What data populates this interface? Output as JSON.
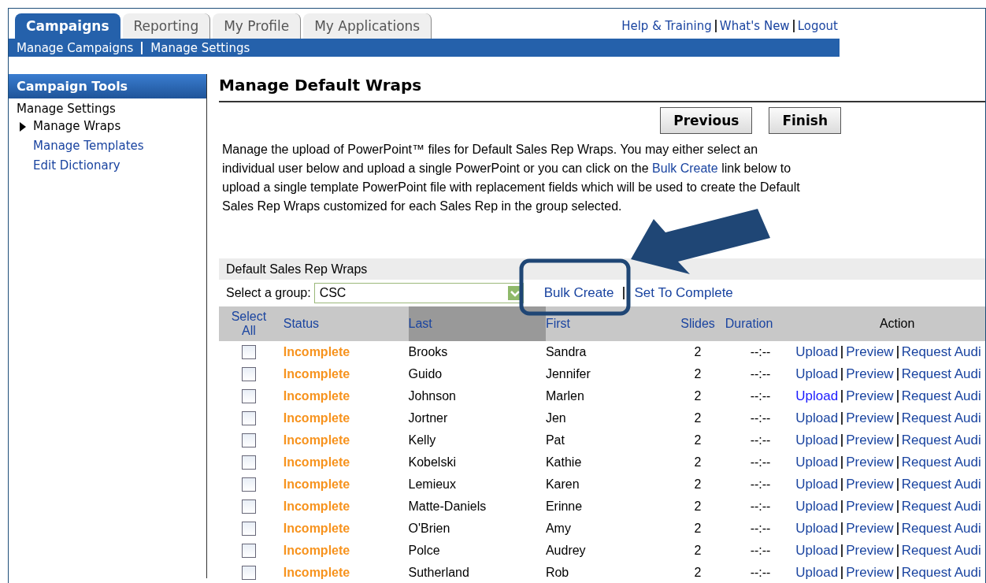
{
  "tabs": [
    {
      "label": "Campaigns",
      "selected": true
    },
    {
      "label": "Reporting",
      "selected": false
    },
    {
      "label": "My Profile",
      "selected": false
    },
    {
      "label": "My Applications",
      "selected": false
    }
  ],
  "top_links": [
    "Help & Training",
    "What's New",
    "Logout"
  ],
  "subnav": [
    "Manage Campaigns",
    "Manage Settings"
  ],
  "sidebar": {
    "title": "Campaign Tools",
    "heading": "Manage Settings",
    "items": [
      {
        "label": "Manage Wraps",
        "selected": true
      },
      {
        "label": "Manage Templates",
        "selected": false
      },
      {
        "label": "Edit Dictionary",
        "selected": false
      }
    ]
  },
  "page_title": "Manage Default Wraps",
  "buttons": [
    "Previous",
    "Finish"
  ],
  "description": "Manage the upload of PowerPoint™ files for Default Sales Rep Wraps. You may either select an individual user below and upload a single PowerPoint or you can click on the ",
  "description_link": "Bulk Create",
  "description_end": " link below to upload a single template PowerPoint file with replacement fields which will be used to create the Default Sales Rep Wraps customized for each Sales Rep in the group selected.",
  "section_title": "Default Sales Rep Wraps",
  "group_label": "Select a group:",
  "group_value": "CSC",
  "group_links": [
    "Bulk Create",
    "Set To Complete"
  ],
  "table": {
    "columns": [
      {
        "label": "Select All",
        "link": true,
        "sorted": false
      },
      {
        "label": "Status",
        "link": true,
        "sorted": false
      },
      {
        "label": "Last",
        "link": true,
        "sorted": true
      },
      {
        "label": "First",
        "link": true,
        "sorted": false
      },
      {
        "label": "Slides",
        "link": true,
        "sorted": false
      },
      {
        "label": "Duration",
        "link": true,
        "sorted": false
      },
      {
        "label": "Action",
        "link": false,
        "sorted": false
      }
    ],
    "rows": [
      {
        "checked": false,
        "status": "Incomplete",
        "last": "Brooks",
        "first": "Sandra",
        "slides": "2",
        "duration": "--:--",
        "actions": [
          "Upload",
          "Preview",
          "Request Audi"
        ],
        "highlighted": false
      },
      {
        "checked": false,
        "status": "Incomplete",
        "last": "Guido",
        "first": "Jennifer",
        "slides": "2",
        "duration": "--:--",
        "actions": [
          "Upload",
          "Preview",
          "Request Audi"
        ],
        "highlighted": false
      },
      {
        "checked": false,
        "status": "Incomplete",
        "last": "Johnson",
        "first": "Marlen",
        "slides": "2",
        "duration": "--:--",
        "actions": [
          "Upload",
          "Preview",
          "Request Audi"
        ],
        "highlighted": true
      },
      {
        "checked": false,
        "status": "Incomplete",
        "last": "Jortner",
        "first": "Jen",
        "slides": "2",
        "duration": "--:--",
        "actions": [
          "Upload",
          "Preview",
          "Request Audi"
        ],
        "highlighted": false
      },
      {
        "checked": false,
        "status": "Incomplete",
        "last": "Kelly",
        "first": "Pat",
        "slides": "2",
        "duration": "--:--",
        "actions": [
          "Upload",
          "Preview",
          "Request Audi"
        ],
        "highlighted": false
      },
      {
        "checked": false,
        "status": "Incomplete",
        "last": "Kobelski",
        "first": "Kathie",
        "slides": "2",
        "duration": "--:--",
        "actions": [
          "Upload",
          "Preview",
          "Request Audi"
        ],
        "highlighted": false
      },
      {
        "checked": false,
        "status": "Incomplete",
        "last": "Lemieux",
        "first": "Karen",
        "slides": "2",
        "duration": "--:--",
        "actions": [
          "Upload",
          "Preview",
          "Request Audi"
        ],
        "highlighted": false
      },
      {
        "checked": false,
        "status": "Incomplete",
        "last": "Matte-Daniels",
        "first": "Erinne",
        "slides": "2",
        "duration": "--:--",
        "actions": [
          "Upload",
          "Preview",
          "Request Audi"
        ],
        "highlighted": false
      },
      {
        "checked": false,
        "status": "Incomplete",
        "last": "O'Brien",
        "first": "Amy",
        "slides": "2",
        "duration": "--:--",
        "actions": [
          "Upload",
          "Preview",
          "Request Audi"
        ],
        "highlighted": false
      },
      {
        "checked": false,
        "status": "Incomplete",
        "last": "Polce",
        "first": "Audrey",
        "slides": "2",
        "duration": "--:--",
        "actions": [
          "Upload",
          "Preview",
          "Request Audi"
        ],
        "highlighted": false
      },
      {
        "checked": false,
        "status": "Incomplete",
        "last": "Sutherland",
        "first": "Rob",
        "slides": "2",
        "duration": "--:--",
        "actions": [
          "Upload",
          "Preview",
          "Request Audi"
        ],
        "highlighted": false
      }
    ]
  }
}
